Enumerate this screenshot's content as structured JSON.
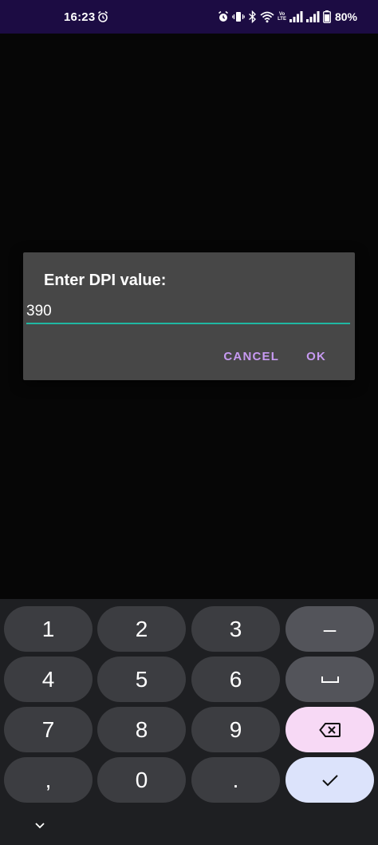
{
  "status_bar": {
    "time": "16:23",
    "battery": "80%",
    "network_label_top": "Vo",
    "network_label_bottom": "LTE",
    "icons": [
      "alarm-icon",
      "vibrate-icon",
      "bluetooth-icon",
      "wifi-icon",
      "lte-icon",
      "signal-icon",
      "signal-icon-2",
      "battery-icon"
    ]
  },
  "dialog": {
    "title": "Enter DPI value:",
    "value": "390",
    "cancel_label": "CANCEL",
    "ok_label": "OK"
  },
  "keyboard": {
    "keys": {
      "k1": "1",
      "k2": "2",
      "k3": "3",
      "minus": "–",
      "k4": "4",
      "k5": "5",
      "k6": "6",
      "k7": "7",
      "k8": "8",
      "k9": "9",
      "comma": ",",
      "k0": "0",
      "period": "."
    },
    "icons": [
      "space-icon",
      "backspace-icon",
      "checkmark-icon",
      "chevron-down-icon"
    ]
  },
  "colors": {
    "status_bar_bg": "#1c0c43",
    "background": "#060606",
    "dialog_bg": "#474747",
    "accent_button": "#c79af2",
    "input_underline": "#20b8a3",
    "keyboard_bg": "#1e1f22",
    "key_bg": "#3c3d41",
    "fn_key_bg": "#53545a",
    "delete_key_bg": "#f7d9f5",
    "done_key_bg": "#dce3fb"
  }
}
